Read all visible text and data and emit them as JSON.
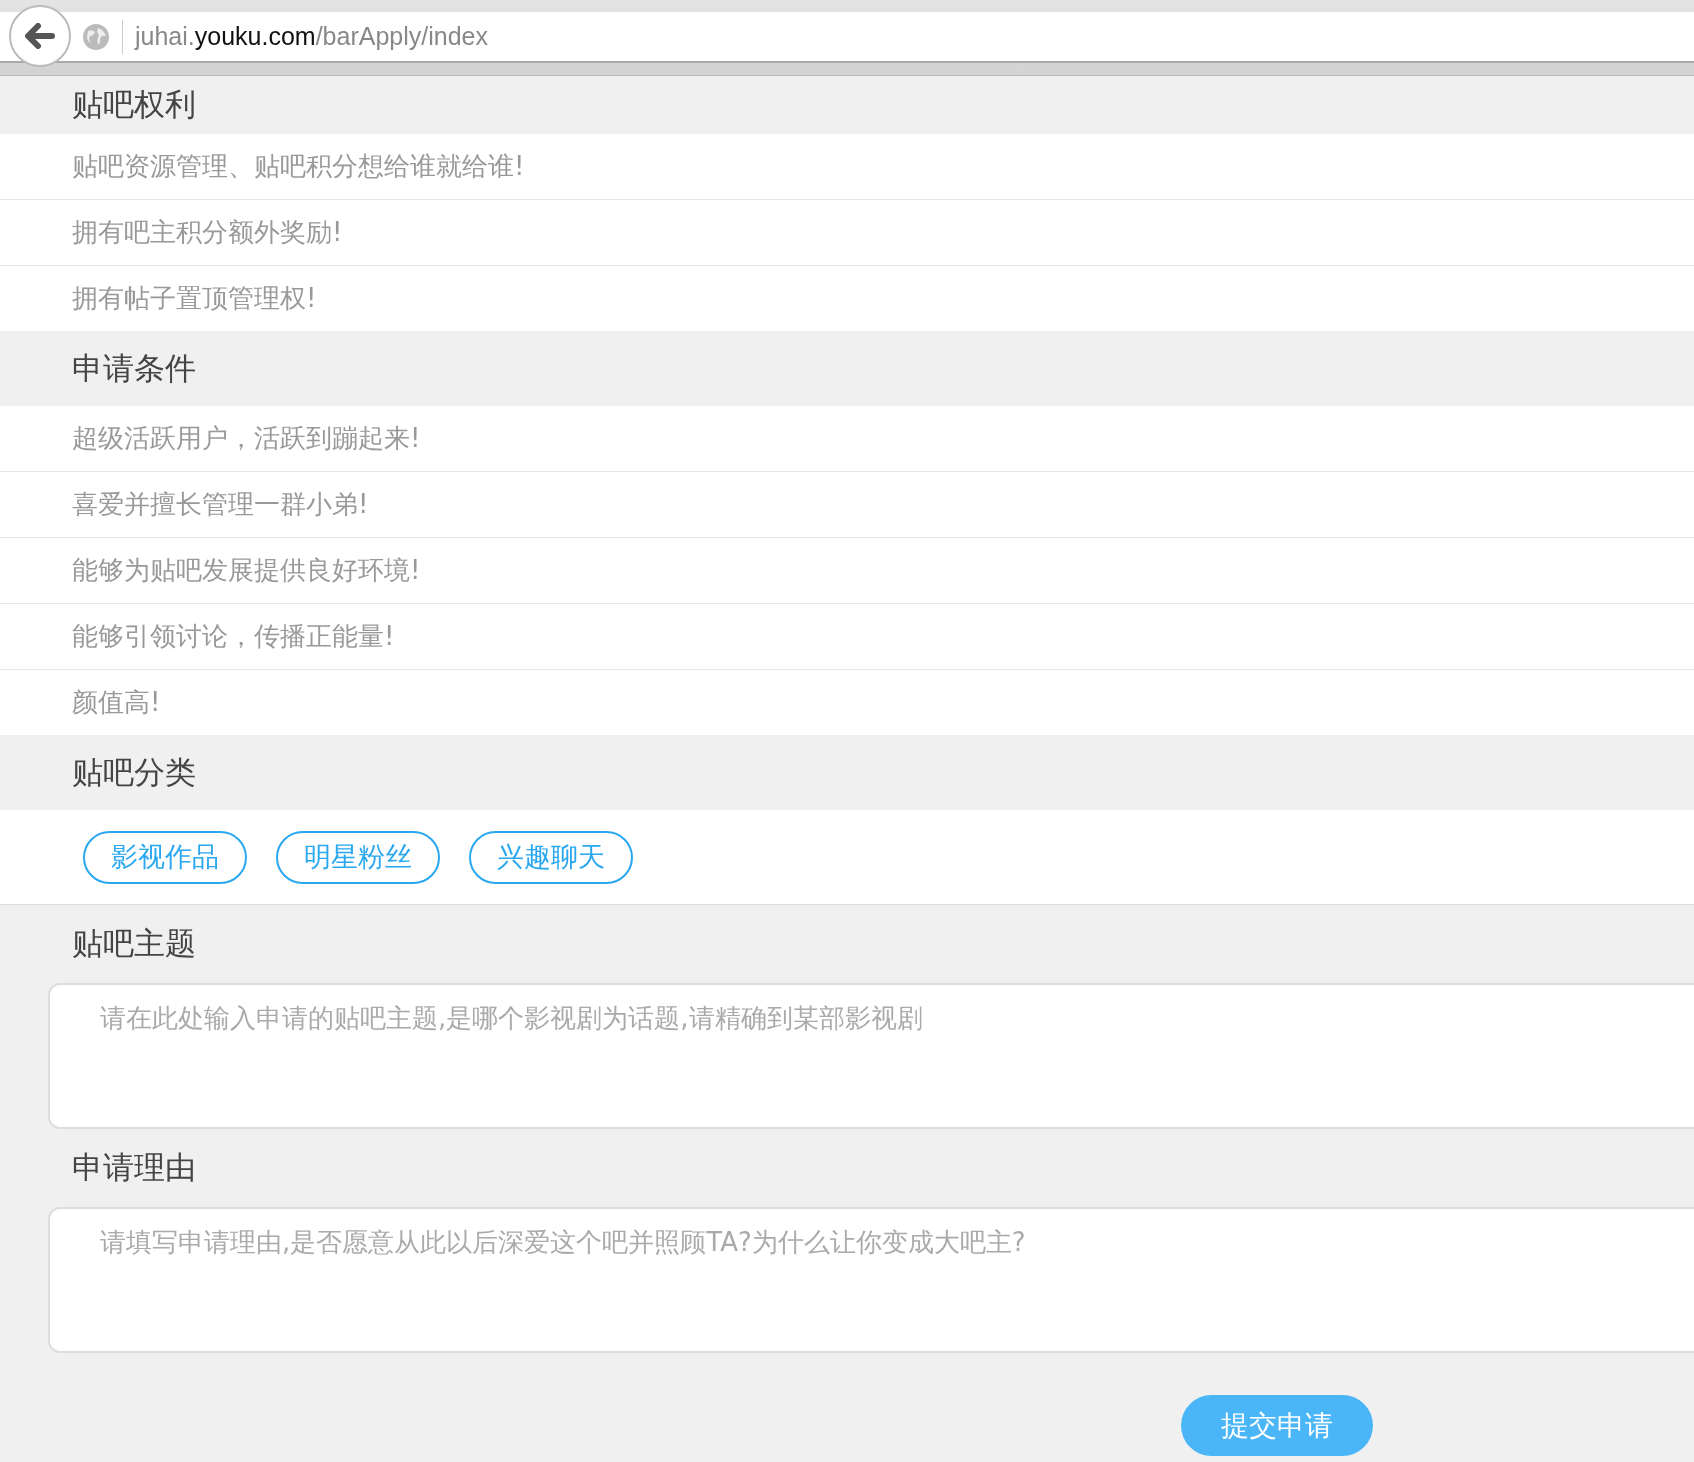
{
  "address_bar": {
    "url_prefix": "juhai.",
    "url_domain": "youku.com",
    "url_path": "/barApply/index"
  },
  "sections": [
    {
      "title": "贴吧权利",
      "items": [
        "贴吧资源管理、贴吧积分想给谁就给谁!",
        "拥有吧主积分额外奖励!",
        "拥有帖子置顶管理权!"
      ]
    },
    {
      "title": "申请条件",
      "items": [
        "超级活跃用户，活跃到蹦起来!",
        "喜爱并擅长管理一群小弟!",
        "能够为贴吧发展提供良好环境!",
        "能够引领讨论，传播正能量!",
        "颜值高!"
      ]
    }
  ],
  "category": {
    "title": "贴吧分类",
    "tags": [
      {
        "label": "影视作品",
        "selected": false
      },
      {
        "label": "明星粉丝",
        "selected": false
      },
      {
        "label": "兴趣聊天",
        "selected": false
      }
    ]
  },
  "fields": [
    {
      "label": "贴吧主题",
      "placeholder": "请在此处输入申请的贴吧主题,是哪个影视剧为话题,请精确到某部影视剧"
    },
    {
      "label": "申请理由",
      "placeholder": "请填写申请理由,是否愿意从此以后深爱这个吧并照顾TA?为什么让你变成大吧主?"
    }
  ],
  "submit_button": "提交申请"
}
